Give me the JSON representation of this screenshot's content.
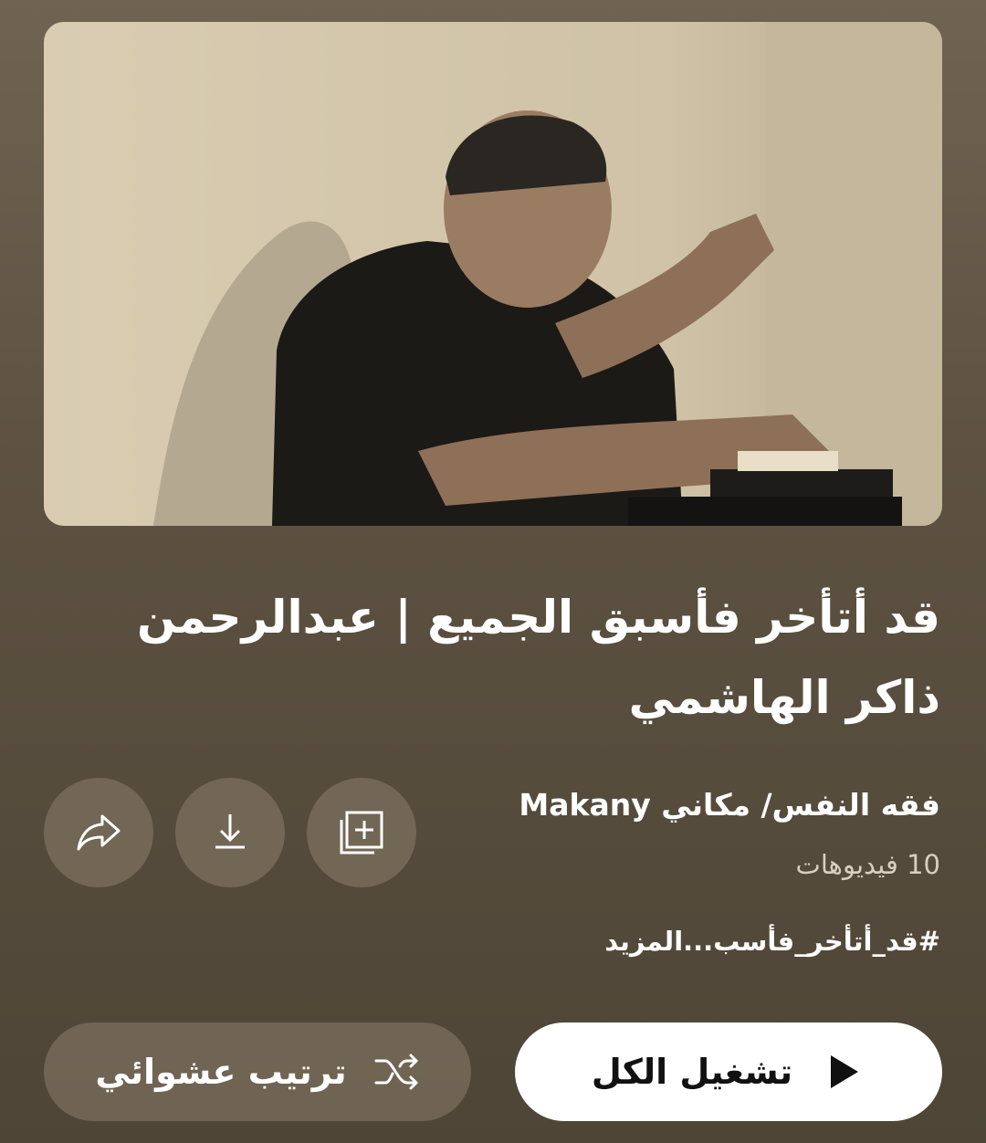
{
  "playlist": {
    "title": "قد أتأخر فأسبق الجميع | عبدالرحمن ذاكر الهاشمي",
    "channel": "فقه النفس/ مكاني Makany",
    "video_count": "10 فيديوهات",
    "hashtag": "#قد_أتأخر_فأسب",
    "more_label": "...المزيد"
  },
  "actions": {
    "save_icon": "playlist-add-icon",
    "download_icon": "download-icon",
    "share_icon": "share-icon"
  },
  "buttons": {
    "play_all": "تشغيل الكل",
    "shuffle": "ترتيب عشوائي"
  },
  "colors": {
    "background": "#5d5242",
    "play_button_bg": "#ffffff",
    "secondary_button_bg": "#8a7e6c"
  }
}
